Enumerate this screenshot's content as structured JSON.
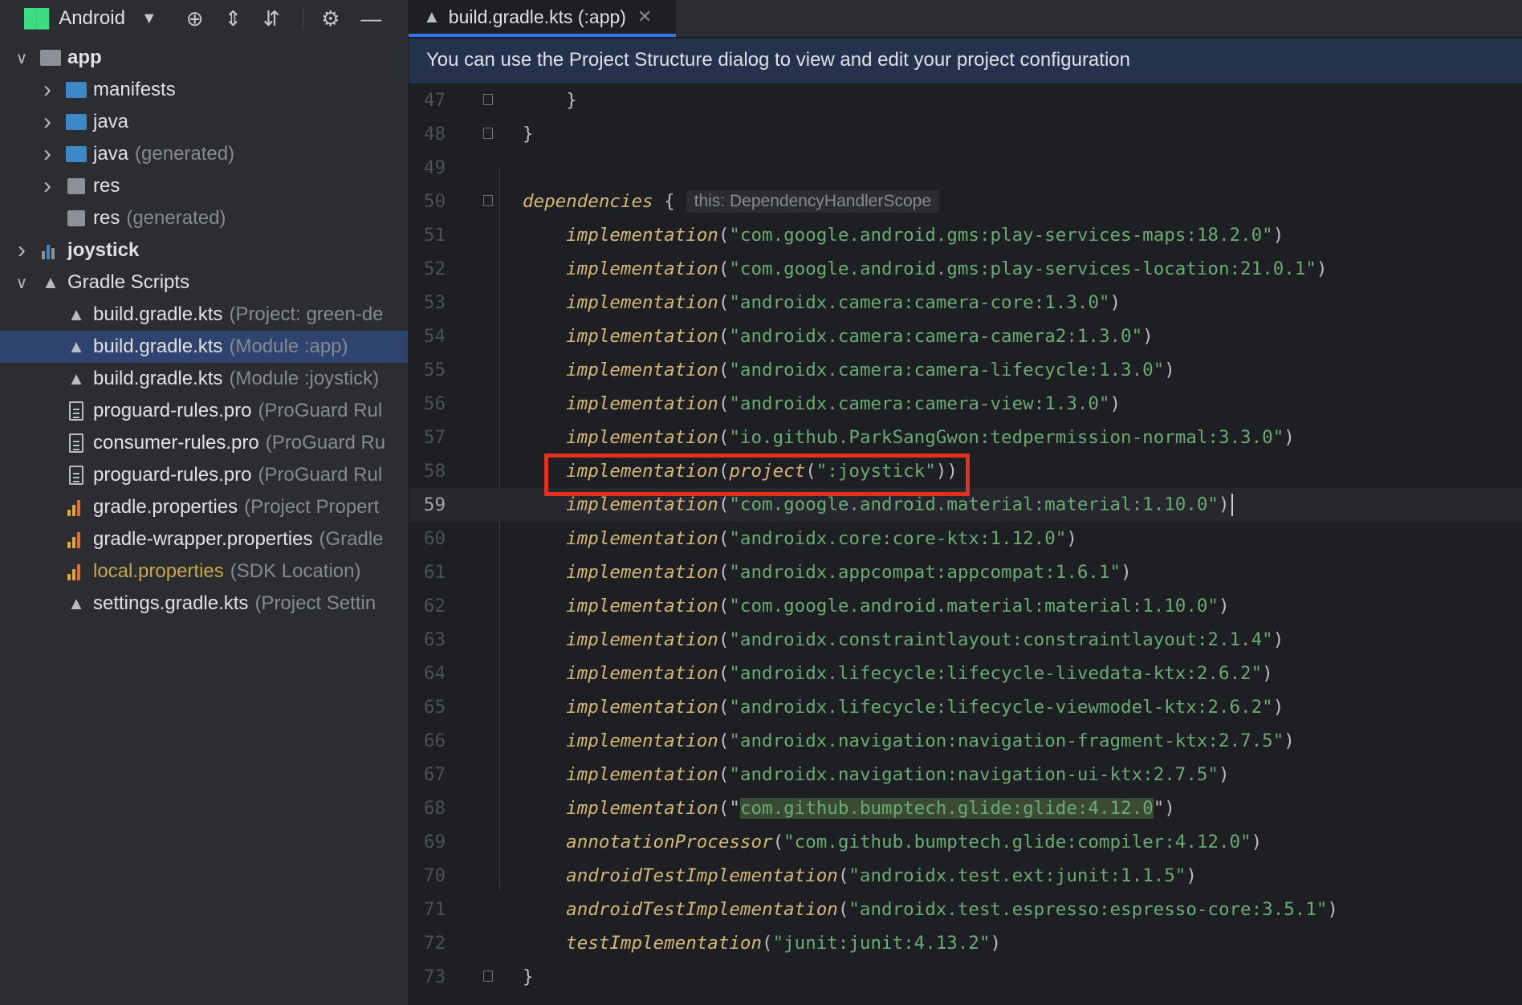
{
  "project_view": {
    "view_label": "Android",
    "toolbar_icons": [
      "locate-icon",
      "expand-all-icon",
      "collapse-all-icon",
      "gear-icon",
      "minimize-icon"
    ],
    "tree": [
      {
        "label": "app",
        "hint": "",
        "level": 0,
        "arrow": "down",
        "icon": "module-folder",
        "bold": true
      },
      {
        "label": "manifests",
        "hint": "",
        "level": 1,
        "arrow": "right",
        "icon": "folder"
      },
      {
        "label": "java",
        "hint": "",
        "level": 1,
        "arrow": "right",
        "icon": "folder"
      },
      {
        "label": "java",
        "hint": "(generated)",
        "level": 1,
        "arrow": "right",
        "icon": "folder-generated"
      },
      {
        "label": "res",
        "hint": "",
        "level": 1,
        "arrow": "right",
        "icon": "res-folder"
      },
      {
        "label": "res",
        "hint": "(generated)",
        "level": 1,
        "arrow": "",
        "icon": "res-folder"
      },
      {
        "label": "joystick",
        "hint": "",
        "level": 0,
        "arrow": "right",
        "icon": "library-module",
        "bold": true
      },
      {
        "label": "Gradle Scripts",
        "hint": "",
        "level": 0,
        "arrow": "down",
        "icon": "gradle"
      },
      {
        "label": "build.gradle.kts",
        "hint": "(Project: green-de",
        "level": 1,
        "arrow": "",
        "icon": "gradle"
      },
      {
        "label": "build.gradle.kts",
        "hint": "(Module :app)",
        "level": 1,
        "arrow": "",
        "icon": "gradle",
        "selected": true
      },
      {
        "label": "build.gradle.kts",
        "hint": "(Module :joystick)",
        "level": 1,
        "arrow": "",
        "icon": "gradle"
      },
      {
        "label": "proguard-rules.pro",
        "hint": "(ProGuard Rul",
        "level": 1,
        "arrow": "",
        "icon": "file"
      },
      {
        "label": "consumer-rules.pro",
        "hint": "(ProGuard Ru",
        "level": 1,
        "arrow": "",
        "icon": "file"
      },
      {
        "label": "proguard-rules.pro",
        "hint": "(ProGuard Rul",
        "level": 1,
        "arrow": "",
        "icon": "file"
      },
      {
        "label": "gradle.properties",
        "hint": "(Project Propert",
        "level": 1,
        "arrow": "",
        "icon": "properties"
      },
      {
        "label": "gradle-wrapper.properties",
        "hint": "(Gradle",
        "level": 1,
        "arrow": "",
        "icon": "properties"
      },
      {
        "label": "local.properties",
        "hint": "(SDK Location)",
        "level": 1,
        "arrow": "",
        "icon": "properties",
        "local": true
      },
      {
        "label": "settings.gradle.kts",
        "hint": "(Project Settin",
        "level": 1,
        "arrow": "",
        "icon": "gradle"
      }
    ]
  },
  "editor": {
    "tab": {
      "label": "build.gradle.kts (:app)",
      "close": "✕"
    },
    "banner": "You can use the Project Structure dialog to view and edit your project configuration",
    "inlay_hint": "this: DependencyHandlerScope",
    "current_line": 59,
    "lines": [
      {
        "n": "47",
        "parts": [
          [
            "punc",
            "    }"
          ]
        ]
      },
      {
        "n": "48",
        "parts": [
          [
            "punc",
            "}"
          ]
        ]
      },
      {
        "n": "49",
        "parts": []
      },
      {
        "n": "50",
        "parts": [
          [
            "kw",
            "dependencies"
          ],
          [
            "punc",
            " {"
          ]
        ],
        "inlay": true
      },
      {
        "n": "51",
        "parts": [
          [
            "kw",
            "    implementation"
          ],
          [
            "punc",
            "("
          ],
          [
            "str",
            "\"com.google.android.gms:play-services-maps:18.2.0\""
          ],
          [
            "punc",
            ")"
          ]
        ]
      },
      {
        "n": "52",
        "parts": [
          [
            "kw",
            "    implementation"
          ],
          [
            "punc",
            "("
          ],
          [
            "str",
            "\"com.google.android.gms:play-services-location:21.0.1\""
          ],
          [
            "punc",
            ")"
          ]
        ]
      },
      {
        "n": "53",
        "parts": [
          [
            "kw",
            "    implementation"
          ],
          [
            "punc",
            "("
          ],
          [
            "str",
            "\"androidx.camera:camera-core:1.3.0\""
          ],
          [
            "punc",
            ")"
          ]
        ]
      },
      {
        "n": "54",
        "parts": [
          [
            "kw",
            "    implementation"
          ],
          [
            "punc",
            "("
          ],
          [
            "str",
            "\"androidx.camera:camera-camera2:1.3.0\""
          ],
          [
            "punc",
            ")"
          ]
        ]
      },
      {
        "n": "55",
        "parts": [
          [
            "kw",
            "    implementation"
          ],
          [
            "punc",
            "("
          ],
          [
            "str",
            "\"androidx.camera:camera-lifecycle:1.3.0\""
          ],
          [
            "punc",
            ")"
          ]
        ]
      },
      {
        "n": "56",
        "parts": [
          [
            "kw",
            "    implementation"
          ],
          [
            "punc",
            "("
          ],
          [
            "str",
            "\"androidx.camera:camera-view:1.3.0\""
          ],
          [
            "punc",
            ")"
          ]
        ]
      },
      {
        "n": "57",
        "parts": [
          [
            "kw",
            "    implementation"
          ],
          [
            "punc",
            "("
          ],
          [
            "str",
            "\"io.github.ParkSangGwon:tedpermission-normal:3.3.0\""
          ],
          [
            "punc",
            ")"
          ]
        ]
      },
      {
        "n": "58",
        "parts": [
          [
            "kw",
            "    implementation"
          ],
          [
            "punc",
            "("
          ],
          [
            "kw",
            "project"
          ],
          [
            "punc",
            "("
          ],
          [
            "str",
            "\":joystick\""
          ],
          [
            "punc",
            "))"
          ]
        ]
      },
      {
        "n": "59",
        "parts": [
          [
            "kw",
            "    implementation"
          ],
          [
            "punc",
            "("
          ],
          [
            "str",
            "\"com.google.android.material:material:1.10.0\""
          ],
          [
            "punc",
            ")"
          ]
        ]
      },
      {
        "n": "60",
        "parts": [
          [
            "kw",
            "    implementation"
          ],
          [
            "punc",
            "("
          ],
          [
            "str",
            "\"androidx.core:core-ktx:1.12.0\""
          ],
          [
            "punc",
            ")"
          ]
        ]
      },
      {
        "n": "61",
        "parts": [
          [
            "kw",
            "    implementation"
          ],
          [
            "punc",
            "("
          ],
          [
            "str",
            "\"androidx.appcompat:appcompat:1.6.1\""
          ],
          [
            "punc",
            ")"
          ]
        ]
      },
      {
        "n": "62",
        "parts": [
          [
            "kw",
            "    implementation"
          ],
          [
            "punc",
            "("
          ],
          [
            "str",
            "\"com.google.android.material:material:1.10.0\""
          ],
          [
            "punc",
            ")"
          ]
        ]
      },
      {
        "n": "63",
        "parts": [
          [
            "kw",
            "    implementation"
          ],
          [
            "punc",
            "("
          ],
          [
            "str",
            "\"androidx.constraintlayout:constraintlayout:2.1.4\""
          ],
          [
            "punc",
            ")"
          ]
        ]
      },
      {
        "n": "64",
        "parts": [
          [
            "kw",
            "    implementation"
          ],
          [
            "punc",
            "("
          ],
          [
            "str",
            "\"androidx.lifecycle:lifecycle-livedata-ktx:2.6.2\""
          ],
          [
            "punc",
            ")"
          ]
        ]
      },
      {
        "n": "65",
        "parts": [
          [
            "kw",
            "    implementation"
          ],
          [
            "punc",
            "("
          ],
          [
            "str",
            "\"androidx.lifecycle:lifecycle-viewmodel-ktx:2.6.2\""
          ],
          [
            "punc",
            ")"
          ]
        ]
      },
      {
        "n": "66",
        "parts": [
          [
            "kw",
            "    implementation"
          ],
          [
            "punc",
            "("
          ],
          [
            "str",
            "\"androidx.navigation:navigation-fragment-ktx:2.7.5\""
          ],
          [
            "punc",
            ")"
          ]
        ]
      },
      {
        "n": "67",
        "parts": [
          [
            "kw",
            "    implementation"
          ],
          [
            "punc",
            "("
          ],
          [
            "str",
            "\"androidx.navigation:navigation-ui-ktx:2.7.5\""
          ],
          [
            "punc",
            ")"
          ]
        ]
      },
      {
        "n": "68",
        "parts": [
          [
            "kw",
            "    implementation"
          ],
          [
            "punc",
            "(\""
          ],
          [
            "strhl",
            "com.github.bumptech.glide:glide:4.12.0"
          ],
          [
            "punc",
            "\")"
          ]
        ]
      },
      {
        "n": "69",
        "parts": [
          [
            "kw",
            "    annotationProcessor"
          ],
          [
            "punc",
            "("
          ],
          [
            "str",
            "\"com.github.bumptech.glide:compiler:4.12.0\""
          ],
          [
            "punc",
            ")"
          ]
        ]
      },
      {
        "n": "70",
        "parts": [
          [
            "kw",
            "    androidTestImplementation"
          ],
          [
            "punc",
            "("
          ],
          [
            "str",
            "\"androidx.test.ext:junit:1.1.5\""
          ],
          [
            "punc",
            ")"
          ]
        ]
      },
      {
        "n": "71",
        "parts": [
          [
            "kw",
            "    androidTestImplementation"
          ],
          [
            "punc",
            "("
          ],
          [
            "str",
            "\"androidx.test.espresso:espresso-core:3.5.1\""
          ],
          [
            "punc",
            ")"
          ]
        ]
      },
      {
        "n": "72",
        "parts": [
          [
            "kw",
            "    testImplementation"
          ],
          [
            "punc",
            "("
          ],
          [
            "str",
            "\"junit:junit:4.13.2\""
          ],
          [
            "punc",
            ")"
          ]
        ]
      },
      {
        "n": "73",
        "parts": [
          [
            "punc",
            "}"
          ]
        ]
      }
    ]
  }
}
